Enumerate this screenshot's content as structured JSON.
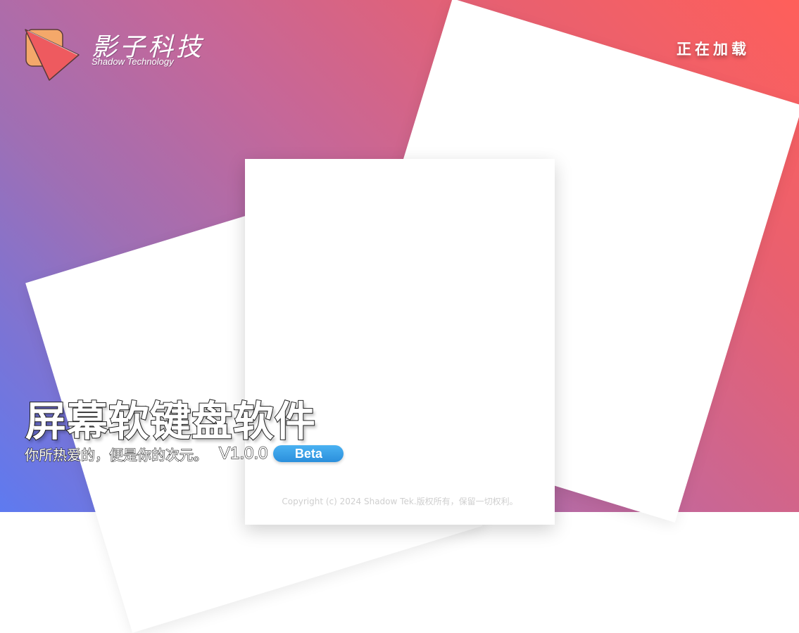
{
  "brand": {
    "name": "影子科技",
    "subtitle": "Shadow Technology",
    "logo_icon": "play-triangle-icon"
  },
  "status": {
    "loading_label": "正在加载"
  },
  "product": {
    "title": "屏幕软键盘软件",
    "tagline": "你所热爱的，便是你的次元。",
    "version": "V1.0.0",
    "badge": "Beta"
  },
  "footer": {
    "copyright": "Copyright (c) 2024 Shadow Tek.版权所有，保留一切权利。"
  },
  "colors": {
    "gradient_top_right": "#ff5f5a",
    "gradient_bottom_left": "#5e7af0",
    "badge": "#3ba3ea",
    "logo_back": "#f4a86a",
    "logo_front": "#ee5a5f"
  }
}
